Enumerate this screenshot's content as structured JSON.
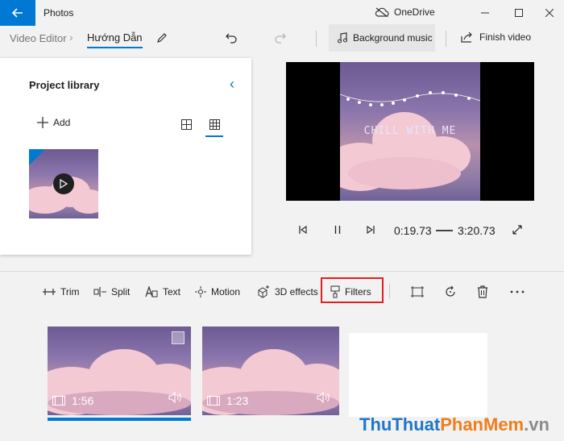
{
  "window": {
    "app_title": "Photos",
    "cloud_label": "OneDrive"
  },
  "breadcrumb": {
    "root": "Video Editor",
    "current": "Hướng Dẫn"
  },
  "toolbar": {
    "background_music": "Background music",
    "finish_video": "Finish video"
  },
  "library": {
    "title": "Project library",
    "add_label": "Add"
  },
  "preview": {
    "overlay_text": "CHILL WITH ME",
    "current_time": "0:19.73",
    "total_time": "3:20.73"
  },
  "edit_tools": {
    "trim": "Trim",
    "split": "Split",
    "text": "Text",
    "motion": "Motion",
    "effects_3d": "3D effects",
    "filters": "Filters"
  },
  "storyboard": {
    "clips": [
      {
        "duration": "1:56"
      },
      {
        "duration": "1:23"
      }
    ]
  },
  "watermark": {
    "part1": "ThuThuat",
    "part2": "PhanMem",
    "part3": ".vn"
  },
  "colors": {
    "accent": "#0078d4",
    "highlight_box": "#e02020"
  }
}
